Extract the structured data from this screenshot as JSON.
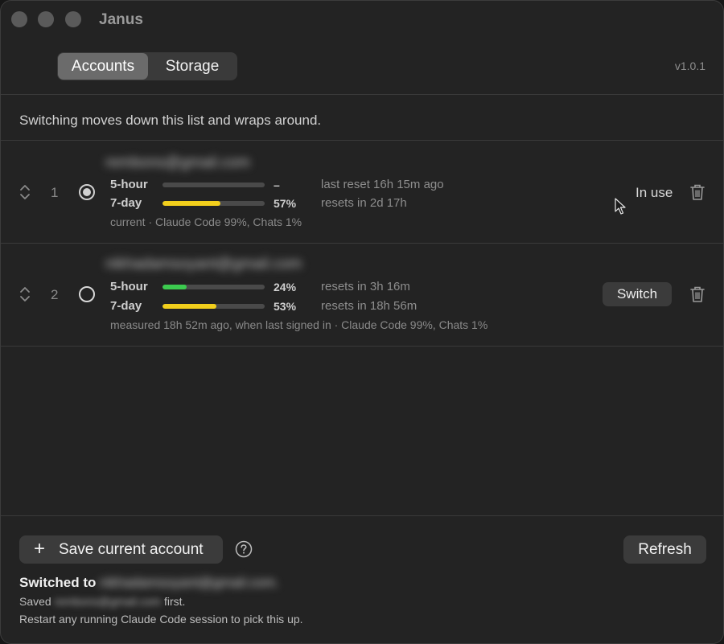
{
  "window": {
    "title": "Janus",
    "version": "v1.0.1"
  },
  "tabs": {
    "accounts_label": "Accounts",
    "storage_label": "Storage",
    "active": "Accounts"
  },
  "hint": "Switching moves down this list and wraps around.",
  "accounts": [
    {
      "index": "1",
      "selected": true,
      "email": "rembons@gmail.com",
      "five_hour": {
        "label": "5-hour",
        "percent_text": "–",
        "percent": 0,
        "reset": "last reset 16h 15m ago"
      },
      "seven_day": {
        "label": "7-day",
        "percent_text": "57%",
        "percent": 57,
        "color": "#f2cf1c",
        "reset": "resets in 2d 17h"
      },
      "subtitle": "current  ·  Claude Code 99%, Chats 1%",
      "status": "In use"
    },
    {
      "index": "2",
      "selected": false,
      "email": "nikhadamsoyant@gmail.com",
      "five_hour": {
        "label": "5-hour",
        "percent_text": "24%",
        "percent": 24,
        "color": "#3ccb4f",
        "reset": "resets in 3h 16m"
      },
      "seven_day": {
        "label": "7-day",
        "percent_text": "53%",
        "percent": 53,
        "color": "#f2cf1c",
        "reset": "resets in 18h 56m"
      },
      "subtitle": "measured 18h 52m ago, when last signed in  ·  Claude Code 99%, Chats 1%",
      "action": "Switch"
    }
  ],
  "footer": {
    "save_label": "Save current account",
    "refresh_label": "Refresh",
    "status_line1_prefix": "Switched to",
    "status_line1_email": "nikhadamsoyant@gmail.com.",
    "status_line2_prefix": "Saved",
    "status_line2_email": "rembons@gmail.com",
    "status_line2_suffix": "first.",
    "status_line3": "Restart any running Claude Code session to pick this up."
  },
  "icons": {
    "sort": "chevron-up-down-icon",
    "trash": "trash-icon",
    "plus": "plus-icon",
    "help": "question-circle-icon",
    "cursor": "mouse-pointer-icon"
  }
}
